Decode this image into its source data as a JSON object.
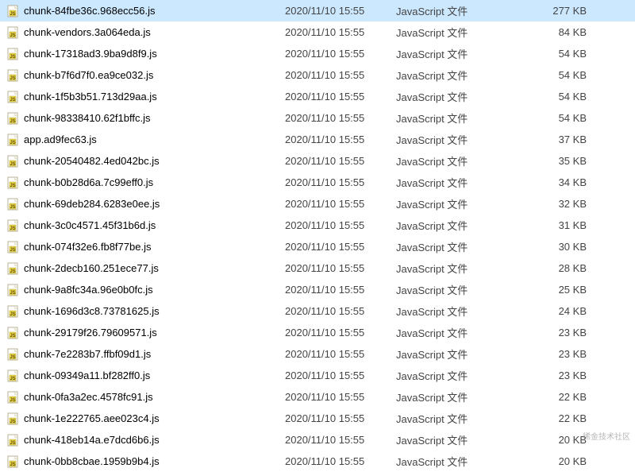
{
  "watermark": "稀金技术社区",
  "files": [
    {
      "name": "chunk-84fbe36c.968ecc56.js",
      "date": "2020/11/10 15:55",
      "type": "JavaScript 文件",
      "size": "277 KB",
      "selected": true
    },
    {
      "name": "chunk-vendors.3a064eda.js",
      "date": "2020/11/10 15:55",
      "type": "JavaScript 文件",
      "size": "84 KB",
      "selected": false
    },
    {
      "name": "chunk-17318ad3.9ba9d8f9.js",
      "date": "2020/11/10 15:55",
      "type": "JavaScript 文件",
      "size": "54 KB",
      "selected": false
    },
    {
      "name": "chunk-b7f6d7f0.ea9ce032.js",
      "date": "2020/11/10 15:55",
      "type": "JavaScript 文件",
      "size": "54 KB",
      "selected": false
    },
    {
      "name": "chunk-1f5b3b51.713d29aa.js",
      "date": "2020/11/10 15:55",
      "type": "JavaScript 文件",
      "size": "54 KB",
      "selected": false
    },
    {
      "name": "chunk-98338410.62f1bffc.js",
      "date": "2020/11/10 15:55",
      "type": "JavaScript 文件",
      "size": "54 KB",
      "selected": false
    },
    {
      "name": "app.ad9fec63.js",
      "date": "2020/11/10 15:55",
      "type": "JavaScript 文件",
      "size": "37 KB",
      "selected": false
    },
    {
      "name": "chunk-20540482.4ed042bc.js",
      "date": "2020/11/10 15:55",
      "type": "JavaScript 文件",
      "size": "35 KB",
      "selected": false
    },
    {
      "name": "chunk-b0b28d6a.7c99eff0.js",
      "date": "2020/11/10 15:55",
      "type": "JavaScript 文件",
      "size": "34 KB",
      "selected": false
    },
    {
      "name": "chunk-69deb284.6283e0ee.js",
      "date": "2020/11/10 15:55",
      "type": "JavaScript 文件",
      "size": "32 KB",
      "selected": false
    },
    {
      "name": "chunk-3c0c4571.45f31b6d.js",
      "date": "2020/11/10 15:55",
      "type": "JavaScript 文件",
      "size": "31 KB",
      "selected": false
    },
    {
      "name": "chunk-074f32e6.fb8f77be.js",
      "date": "2020/11/10 15:55",
      "type": "JavaScript 文件",
      "size": "30 KB",
      "selected": false
    },
    {
      "name": "chunk-2decb160.251ece77.js",
      "date": "2020/11/10 15:55",
      "type": "JavaScript 文件",
      "size": "28 KB",
      "selected": false
    },
    {
      "name": "chunk-9a8fc34a.96e0b0fc.js",
      "date": "2020/11/10 15:55",
      "type": "JavaScript 文件",
      "size": "25 KB",
      "selected": false
    },
    {
      "name": "chunk-1696d3c8.73781625.js",
      "date": "2020/11/10 15:55",
      "type": "JavaScript 文件",
      "size": "24 KB",
      "selected": false
    },
    {
      "name": "chunk-29179f26.79609571.js",
      "date": "2020/11/10 15:55",
      "type": "JavaScript 文件",
      "size": "23 KB",
      "selected": false
    },
    {
      "name": "chunk-7e2283b7.ffbf09d1.js",
      "date": "2020/11/10 15:55",
      "type": "JavaScript 文件",
      "size": "23 KB",
      "selected": false
    },
    {
      "name": "chunk-09349a11.bf282ff0.js",
      "date": "2020/11/10 15:55",
      "type": "JavaScript 文件",
      "size": "23 KB",
      "selected": false
    },
    {
      "name": "chunk-0fa3a2ec.4578fc91.js",
      "date": "2020/11/10 15:55",
      "type": "JavaScript 文件",
      "size": "22 KB",
      "selected": false
    },
    {
      "name": "chunk-1e222765.aee023c4.js",
      "date": "2020/11/10 15:55",
      "type": "JavaScript 文件",
      "size": "22 KB",
      "selected": false
    },
    {
      "name": "chunk-418eb14a.e7dcd6b6.js",
      "date": "2020/11/10 15:55",
      "type": "JavaScript 文件",
      "size": "20 KB",
      "selected": false
    },
    {
      "name": "chunk-0bb8cbae.1959b9b4.js",
      "date": "2020/11/10 15:55",
      "type": "JavaScript 文件",
      "size": "20 KB",
      "selected": false
    }
  ]
}
